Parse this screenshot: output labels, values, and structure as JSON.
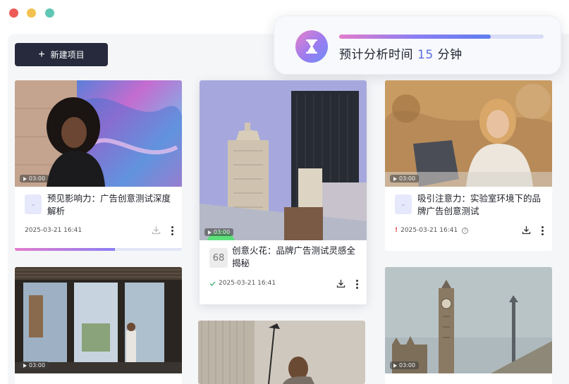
{
  "window": {
    "controls": [
      "close",
      "minimize",
      "maximize"
    ]
  },
  "toolbar": {
    "new_project_label": "新建项目"
  },
  "estimate": {
    "prefix": "预计分析时间",
    "minutes": "15",
    "suffix": "分钟",
    "progress": 0.74,
    "colors": {
      "accent": "#5b6ee0",
      "gradient_start": "#e37ccc",
      "gradient_end": "#5f7df0"
    }
  },
  "cards": [
    {
      "title": "预见影响力：广告创意测试深度解析",
      "timestamp": "2025-03-21 16:41",
      "duration": "03:00",
      "status": "in-progress",
      "progress": 0.6,
      "icon": "document-icon"
    },
    {
      "title": "创意火花：品牌广告测试灵感全揭秘",
      "timestamp": "2025-03-21 16:41",
      "duration": "03:00",
      "status": "done",
      "score": "68"
    },
    {
      "title": "吸引注意力：实验室环境下的品牌广告创意测试",
      "timestamp": "2025-03-21 16:41",
      "duration": "03:00",
      "status": "warning",
      "icon": "document-icon"
    },
    {
      "duration": "03:00"
    },
    {
      "duration": ""
    },
    {
      "duration": "03:00"
    }
  ]
}
